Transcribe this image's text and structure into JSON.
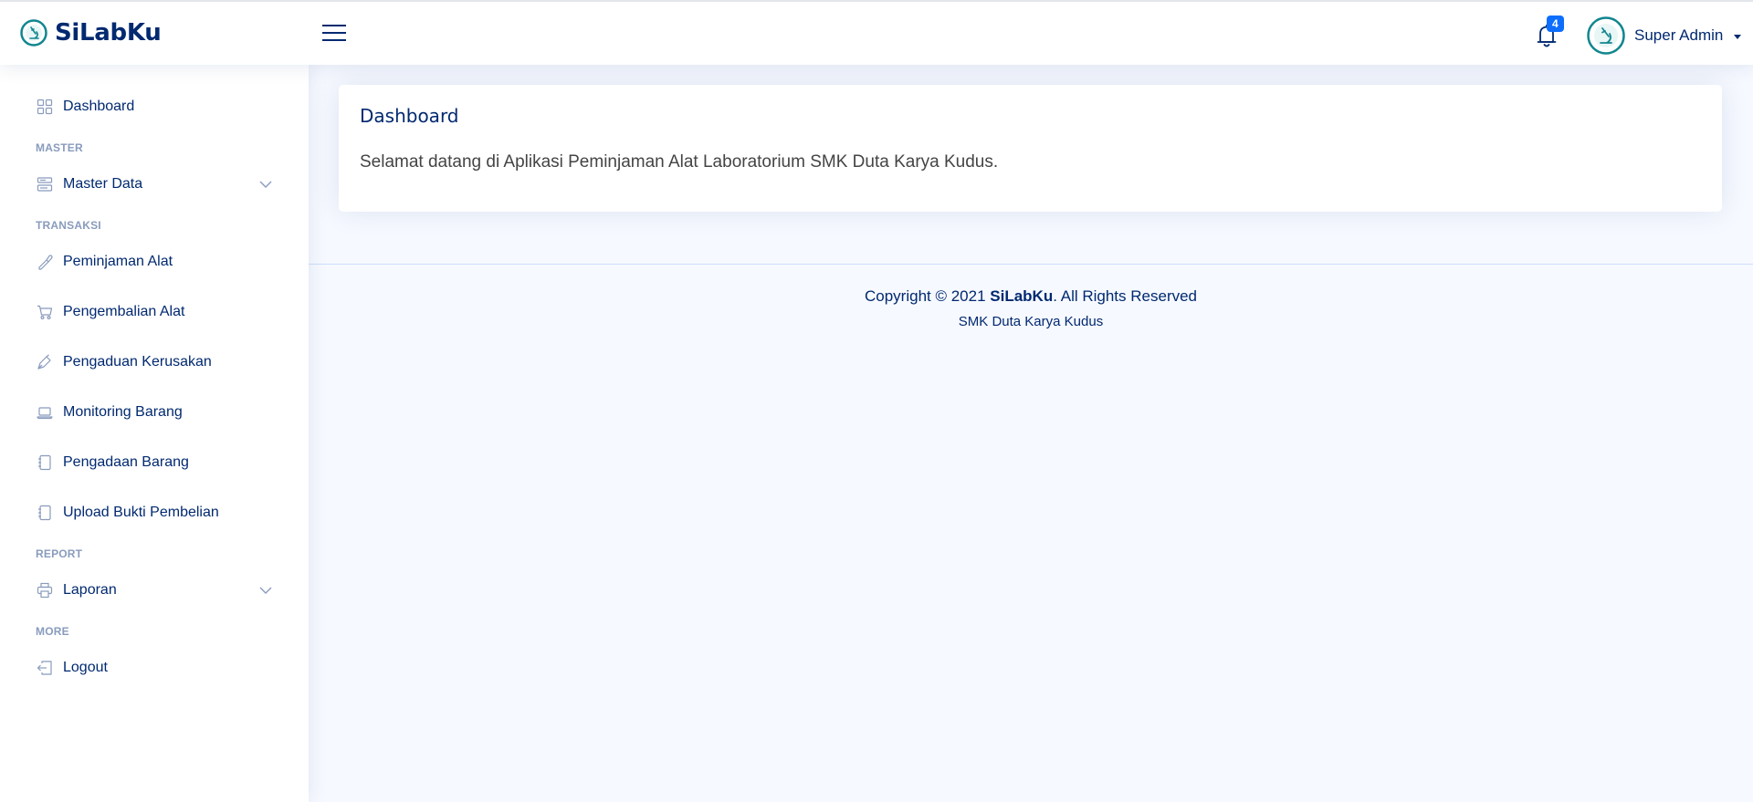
{
  "header": {
    "app_name": "SiLabKu",
    "notification_count": "4",
    "user_name": "Super Admin"
  },
  "sidebar": {
    "items": [
      {
        "label": "Dashboard",
        "icon": "grid-icon"
      },
      {
        "heading": "MASTER"
      },
      {
        "label": "Master Data",
        "icon": "menu-button-icon",
        "expandable": true
      },
      {
        "heading": "TRANSAKSI"
      },
      {
        "label": "Peminjaman Alat",
        "icon": "eyedropper-icon"
      },
      {
        "label": "Pengembalian Alat",
        "icon": "cart-icon"
      },
      {
        "label": "Pengaduan Kerusakan",
        "icon": "pen-icon"
      },
      {
        "label": "Monitoring Barang",
        "icon": "laptop-icon"
      },
      {
        "label": "Pengadaan Barang",
        "icon": "journal-icon"
      },
      {
        "label": "Upload Bukti Pembelian",
        "icon": "journal-icon"
      },
      {
        "heading": "REPORT"
      },
      {
        "label": "Laporan",
        "icon": "printer-icon",
        "expandable": true
      },
      {
        "heading": "MORE"
      },
      {
        "label": "Logout",
        "icon": "box-arrow-in-left-icon"
      }
    ]
  },
  "main": {
    "card_title": "Dashboard",
    "card_text": "Selamat datang di Aplikasi Peminjaman Alat Laboratorium SMK Duta Karya Kudus."
  },
  "footer": {
    "copyright_prefix": "Copyright © 2021 ",
    "copyright_brand": "SiLabKu",
    "copyright_suffix": ". All Rights Reserved",
    "credits": "SMK Duta Karya Kudus"
  },
  "colors": {
    "primary": "#012970",
    "background": "#f6f9ff",
    "badge": "#0d6efd",
    "heading_muted": "#899bbd",
    "logo_teal": "#12868f"
  }
}
